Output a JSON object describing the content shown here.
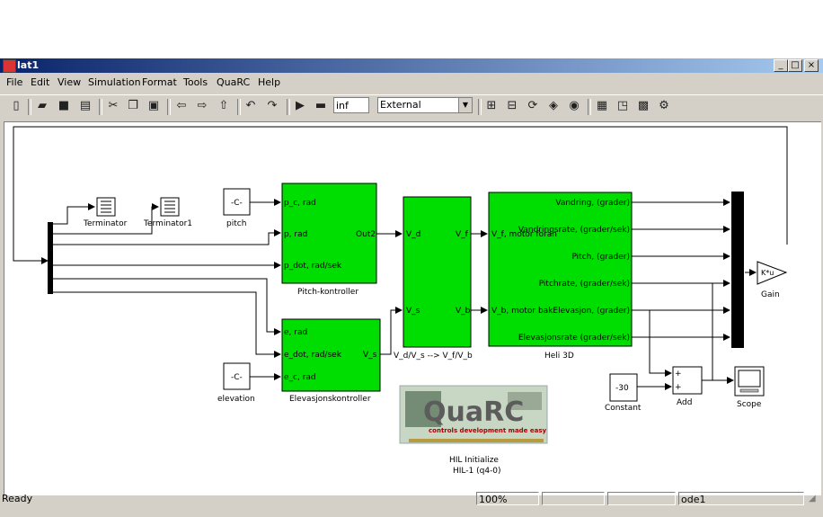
{
  "window": {
    "title": "lat1",
    "min": "_",
    "max": "□",
    "close": "×"
  },
  "menu": [
    "File",
    "Edit",
    "View",
    "Simulation",
    "Format",
    "Tools",
    "QuaRC",
    "Help"
  ],
  "toolbar": {
    "stop_time": "inf",
    "sim_mode": "External"
  },
  "blocks": {
    "terminator": "Terminator",
    "terminator1": "Terminator1",
    "pitch_const": "-C-",
    "pitch_label": "pitch",
    "elev_const": "-C-",
    "elev_label": "elevation",
    "pitch_ctrl": {
      "name": "Pitch-kontroller",
      "in1": "p_c, rad",
      "in2": "p, rad",
      "in3": "p_dot, rad/sek",
      "out": "Out2"
    },
    "elev_ctrl": {
      "name": "Elevasjonskontroller",
      "in1": "e, rad",
      "in2": "e_dot, rad/sek",
      "in3": "e_c, rad",
      "out": "V_s"
    },
    "conv": {
      "name": "V_d/V_s --> V_f/V_b",
      "in1": "V_d",
      "in2": "V_s",
      "out1": "V_f",
      "out2": "V_b"
    },
    "heli": {
      "name": "Heli 3D",
      "in1": "V_f, motor foran",
      "in2": "V_b, motor bak",
      "out1": "Vandring, (grader)",
      "out2": "Vandringsrate, (grader/sek)",
      "out3": "Pitch, (grader)",
      "out4": "Pitchrate, (grader/sek)",
      "out5": "Elevasjon, (grader)",
      "out6": "Elevasjonsrate (grader/sek)"
    },
    "gain": {
      "name": "Gain",
      "symbol": "K*u"
    },
    "constant": {
      "name": "Constant",
      "value": "-30"
    },
    "add": {
      "name": "Add",
      "plus": "+"
    },
    "scope": {
      "name": "Scope"
    },
    "hil": {
      "logo_main": "QuaRC",
      "logo_sub": "controls development made easy",
      "line1": "HIL Initialize",
      "line2": "HIL-1 (q4-0)"
    }
  },
  "status": {
    "text": "Ready",
    "zoom": "100%",
    "solver": "ode1"
  }
}
